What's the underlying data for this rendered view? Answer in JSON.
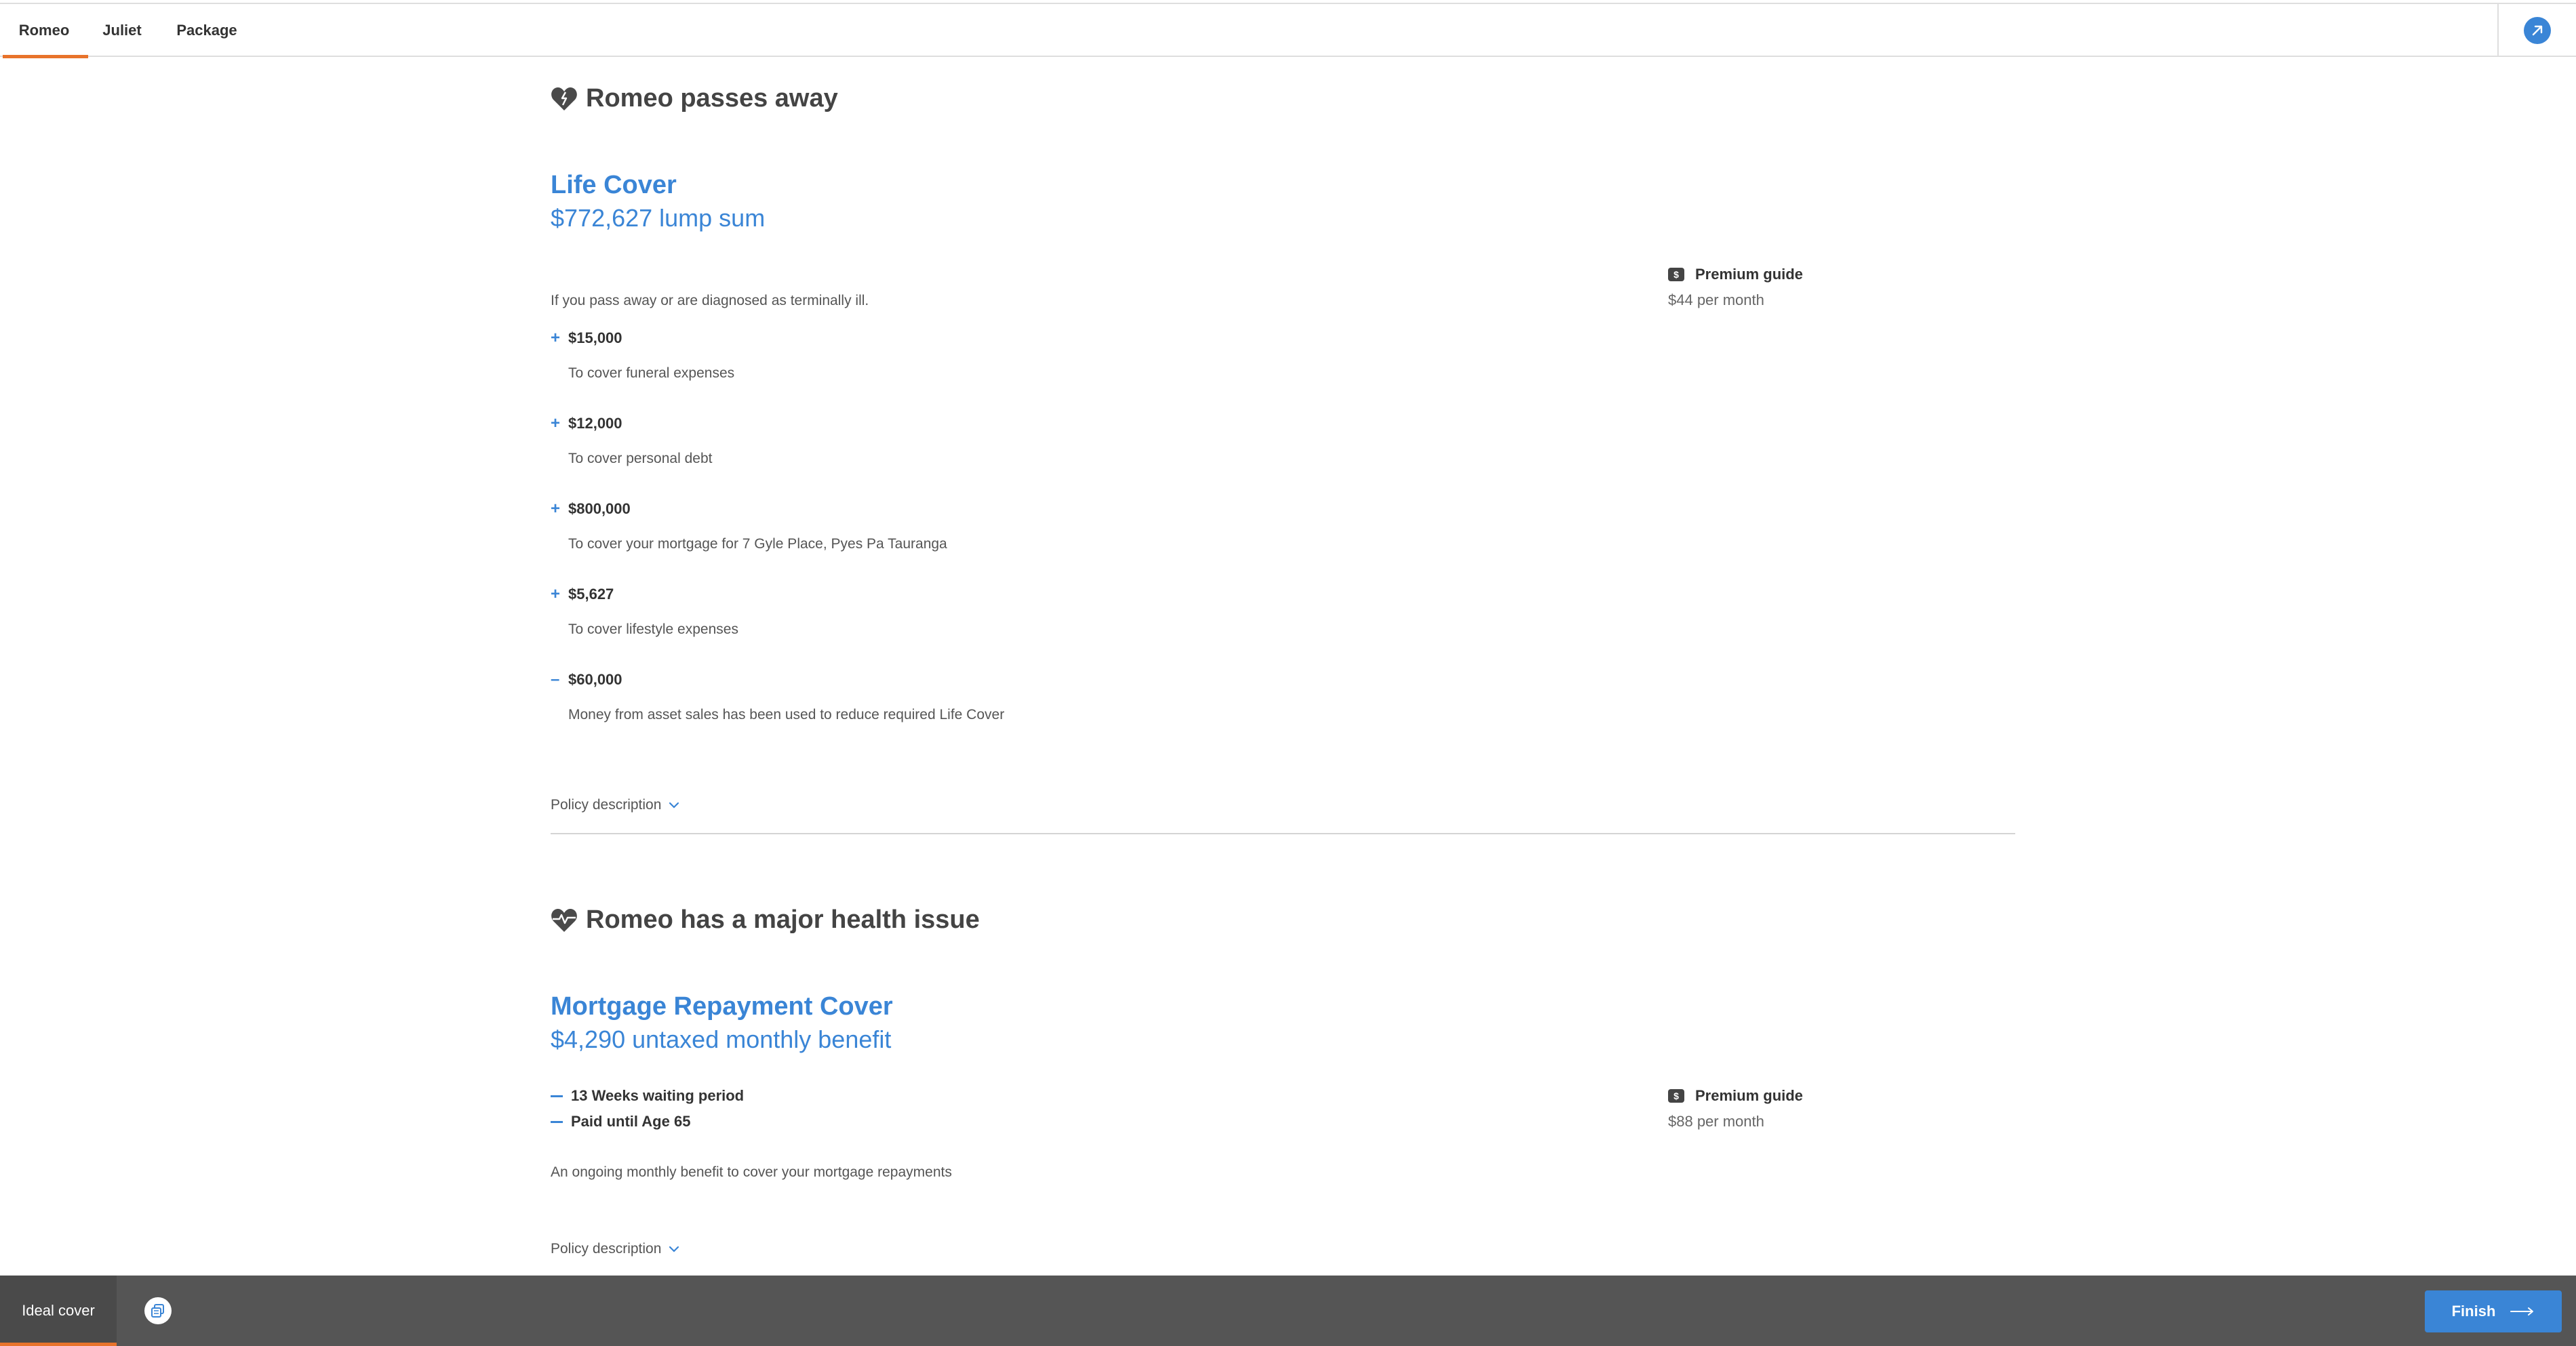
{
  "tabs": [
    {
      "label": "Romeo",
      "active": true
    },
    {
      "label": "Juliet",
      "active": false
    },
    {
      "label": "Package",
      "active": false
    }
  ],
  "section1": {
    "title": "Romeo passes away",
    "cover_name": "Life Cover",
    "cover_amount": "$772,627 lump sum",
    "premium_label": "Premium guide",
    "premium_value": "$44 per month",
    "description": "If you pass away or are diagnosed as terminally ill.",
    "items": [
      {
        "sign": "+",
        "amount": "$15,000",
        "text": "To cover funeral expenses"
      },
      {
        "sign": "+",
        "amount": "$12,000",
        "text": "To cover personal debt"
      },
      {
        "sign": "+",
        "amount": "$800,000",
        "text": "To cover your mortgage for 7 Gyle Place, Pyes Pa Tauranga"
      },
      {
        "sign": "+",
        "amount": "$5,627",
        "text": "To cover lifestyle expenses"
      },
      {
        "sign": "–",
        "amount": "$60,000",
        "text": "Money from asset sales has been used to reduce required Life Cover"
      }
    ],
    "policy_link": "Policy description"
  },
  "section2": {
    "title": "Romeo has a major health issue",
    "cover_name": "Mortgage Repayment Cover",
    "cover_amount": "$4,290 untaxed monthly benefit",
    "premium_label": "Premium guide",
    "premium_value": "$88 per month",
    "terms": [
      "13 Weeks waiting period",
      "Paid until Age 65"
    ],
    "description": "An ongoing monthly benefit to cover your mortgage repayments",
    "policy_link": "Policy description"
  },
  "bottombar": {
    "ideal_label": "Ideal cover",
    "finish_label": "Finish"
  },
  "colors": {
    "accent_blue": "#3a85d6",
    "accent_orange": "#e8732b",
    "bottom_bar": "#555555"
  }
}
